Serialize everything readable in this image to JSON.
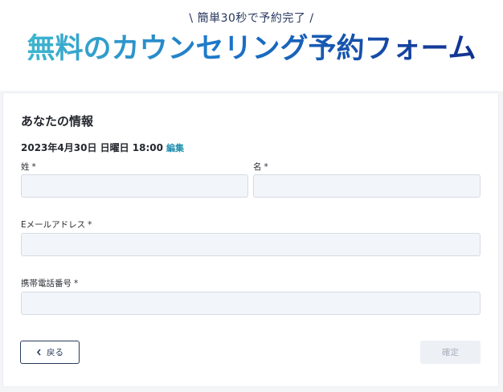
{
  "header": {
    "tagline": "\\ 簡単30秒で予約完了 /",
    "title": "無料のカウンセリング予約フォーム"
  },
  "form": {
    "section_title": "あなたの情報",
    "datetime": "2023年4月30日 日曜日 18:00",
    "edit_label": "編集",
    "required_mark": "*",
    "fields": {
      "last_name": {
        "label": "姓",
        "value": ""
      },
      "first_name": {
        "label": "名",
        "value": ""
      },
      "email": {
        "label": "Eメールアドレス",
        "value": ""
      },
      "phone": {
        "label": "携帯電話番号",
        "value": ""
      }
    },
    "back_label": "戻る",
    "confirm_label": "確定"
  },
  "colors": {
    "title_gradient_start": "#3fb6cf",
    "title_gradient_mid": "#1b73c8",
    "title_gradient_end": "#12318f",
    "link": "#1f8fb0",
    "input_bg": "#f2f5f9",
    "button_border": "#2a3b5c"
  },
  "icons": {
    "back_button": "chevron-left-icon"
  }
}
